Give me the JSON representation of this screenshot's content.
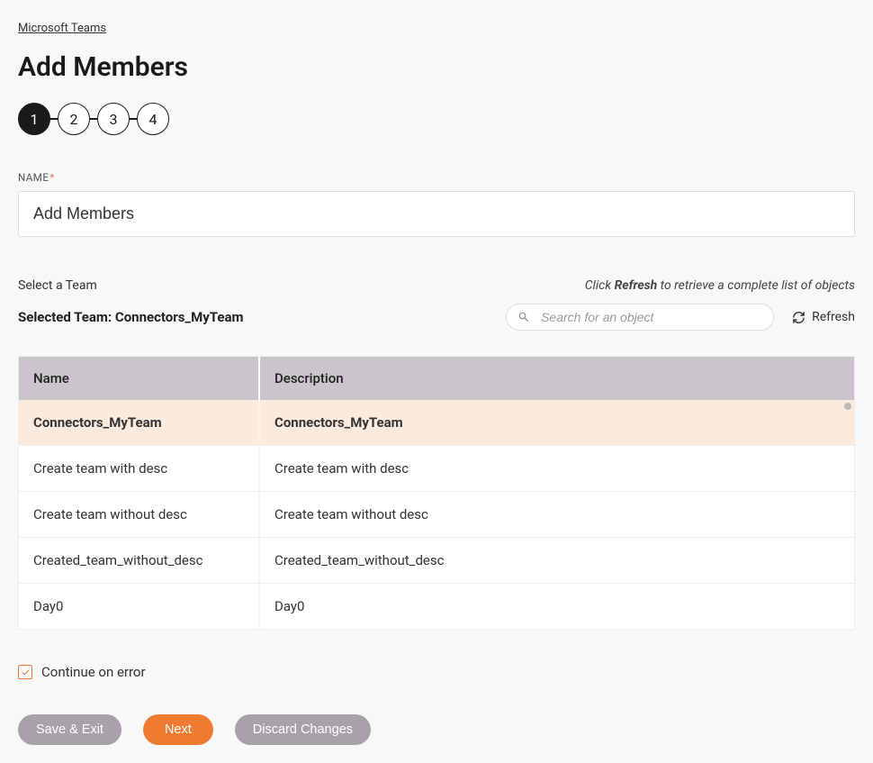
{
  "breadcrumb": "Microsoft Teams",
  "page_title": "Add Members",
  "stepper": [
    "1",
    "2",
    "3",
    "4"
  ],
  "active_step": 0,
  "name_field": {
    "label": "NAME",
    "value": "Add Members"
  },
  "team_section": {
    "select_label": "Select a Team",
    "helper_prefix": "Click ",
    "helper_bold": "Refresh",
    "helper_suffix": " to retrieve a complete list of objects",
    "selected_prefix": "Selected Team: ",
    "selected_value": "Connectors_MyTeam",
    "search_placeholder": "Search for an object",
    "refresh_label": "Refresh"
  },
  "table": {
    "columns": [
      "Name",
      "Description"
    ],
    "rows": [
      {
        "name": "Connectors_MyTeam",
        "description": "Connectors_MyTeam",
        "selected": true
      },
      {
        "name": "Create team with desc",
        "description": "Create team with desc",
        "selected": false
      },
      {
        "name": "Create team without desc",
        "description": "Create team without desc",
        "selected": false
      },
      {
        "name": "Created_team_without_desc",
        "description": "Created_team_without_desc",
        "selected": false
      },
      {
        "name": "Day0",
        "description": "Day0",
        "selected": false
      }
    ]
  },
  "continue_on_error": {
    "label": "Continue on error",
    "checked": true
  },
  "buttons": {
    "save_exit": "Save & Exit",
    "next": "Next",
    "discard": "Discard Changes"
  }
}
